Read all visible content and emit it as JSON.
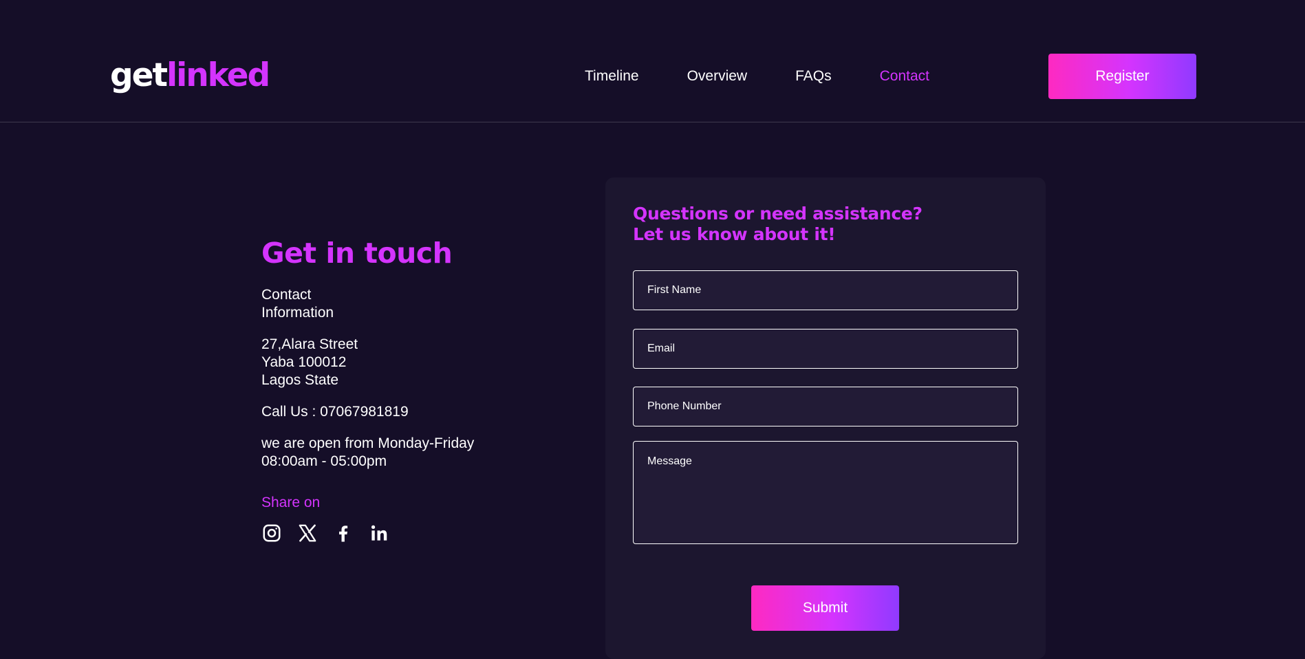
{
  "header": {
    "logo_part1": "get",
    "logo_part2": "linked",
    "nav": [
      {
        "label": "Timeline"
      },
      {
        "label": "Overview"
      },
      {
        "label": "FAQs"
      },
      {
        "label": "Contact"
      }
    ],
    "active_nav": "Contact",
    "register_label": "Register"
  },
  "contact": {
    "title": "Get in touch",
    "info_heading": [
      "Contact",
      "Information"
    ],
    "address": [
      "27,Alara Street",
      "Yaba 100012",
      "Lagos State"
    ],
    "phone": "Call Us : 07067981819",
    "hours": [
      "we are open from Monday-Friday",
      "08:00am - 05:00pm"
    ],
    "share_label": "Share on",
    "socials": [
      "instagram-icon",
      "x-icon",
      "facebook-icon",
      "linkedin-icon"
    ]
  },
  "form": {
    "heading_line1": "Questions or need assistance?",
    "heading_line2": "Let us know about it!",
    "first_name_placeholder": "First Name",
    "email_placeholder": "Email",
    "phone_placeholder": "Phone Number",
    "message_placeholder": "Message",
    "submit_label": "Submit"
  },
  "colors": {
    "background": "#150e28",
    "card": "#1c162f",
    "accent": "#d434fe",
    "gradient_start": "#fe2ac1",
    "gradient_end": "#903aff"
  }
}
